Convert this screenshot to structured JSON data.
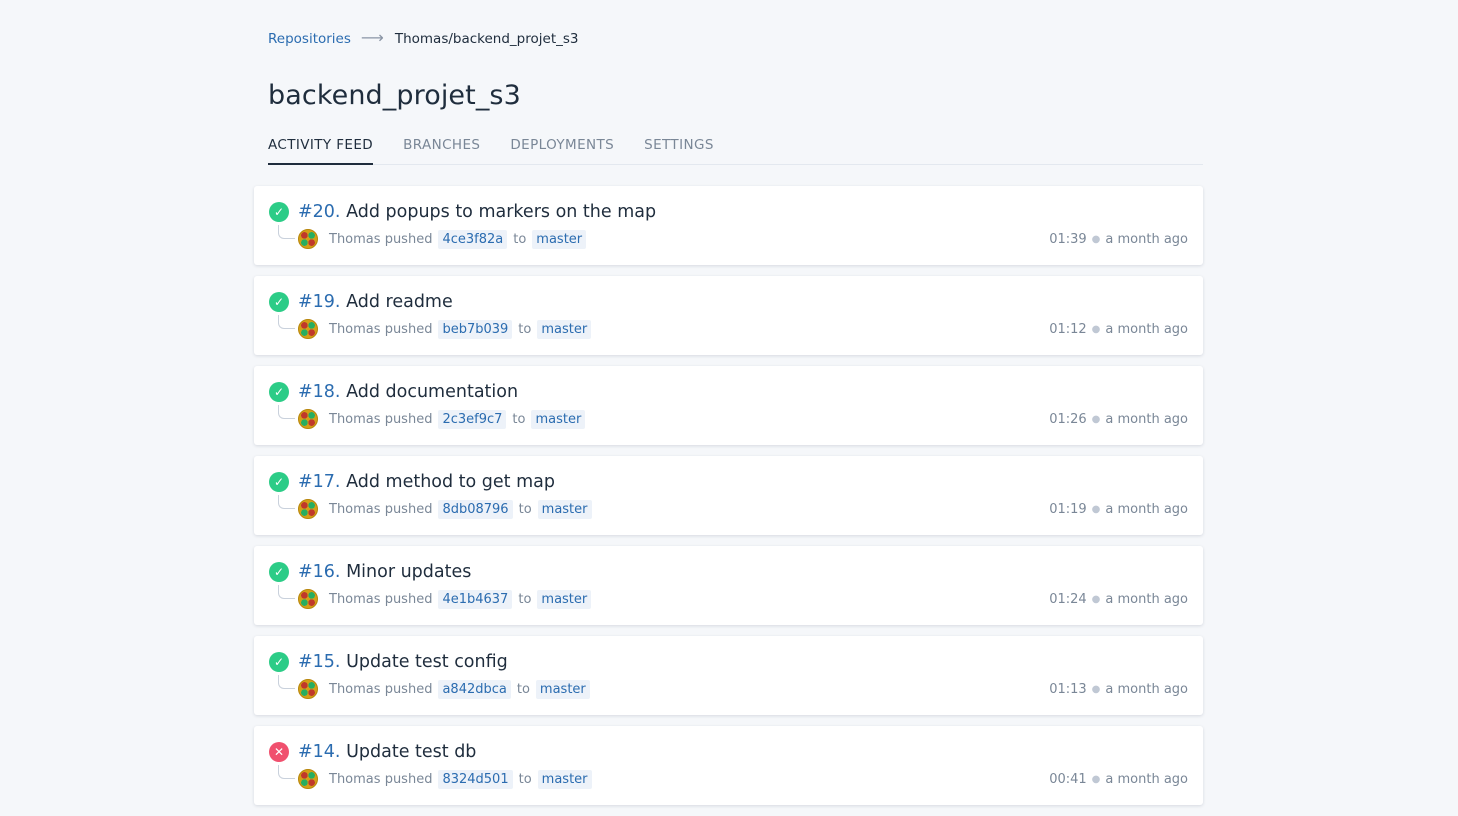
{
  "breadcrumb": {
    "root": "Repositories",
    "arrow": "⟶",
    "current": "Thomas/backend_projet_s3"
  },
  "repo": {
    "title": "backend_projet_s3"
  },
  "tabs": [
    {
      "label": "ACTIVITY FEED",
      "active": true
    },
    {
      "label": "BRANCHES",
      "active": false
    },
    {
      "label": "DEPLOYMENTS",
      "active": false
    },
    {
      "label": "SETTINGS",
      "active": false
    }
  ],
  "feed": [
    {
      "status": "passed",
      "number": "#20.",
      "message": "Add popups to markers on the map",
      "author": "Thomas",
      "action": "pushed",
      "commit": "4ce3f82a",
      "to": "to",
      "branch": "master",
      "duration": "01:39",
      "time": "a month ago"
    },
    {
      "status": "passed",
      "number": "#19.",
      "message": "Add readme",
      "author": "Thomas",
      "action": "pushed",
      "commit": "beb7b039",
      "to": "to",
      "branch": "master",
      "duration": "01:12",
      "time": "a month ago"
    },
    {
      "status": "passed",
      "number": "#18.",
      "message": "Add documentation",
      "author": "Thomas",
      "action": "pushed",
      "commit": "2c3ef9c7",
      "to": "to",
      "branch": "master",
      "duration": "01:26",
      "time": "a month ago"
    },
    {
      "status": "passed",
      "number": "#17.",
      "message": "Add method to get map",
      "author": "Thomas",
      "action": "pushed",
      "commit": "8db08796",
      "to": "to",
      "branch": "master",
      "duration": "01:19",
      "time": "a month ago"
    },
    {
      "status": "passed",
      "number": "#16.",
      "message": "Minor updates",
      "author": "Thomas",
      "action": "pushed",
      "commit": "4e1b4637",
      "to": "to",
      "branch": "master",
      "duration": "01:24",
      "time": "a month ago"
    },
    {
      "status": "passed",
      "number": "#15.",
      "message": "Update test config",
      "author": "Thomas",
      "action": "pushed",
      "commit": "a842dbca",
      "to": "to",
      "branch": "master",
      "duration": "01:13",
      "time": "a month ago"
    },
    {
      "status": "failed",
      "number": "#14.",
      "message": "Update test db",
      "author": "Thomas",
      "action": "pushed",
      "commit": "8324d501",
      "to": "to",
      "branch": "master",
      "duration": "00:41",
      "time": "a month ago"
    }
  ],
  "icons": {
    "passed": "check-circle-icon",
    "failed": "x-circle-icon"
  },
  "colors": {
    "passed": "#2ccc87",
    "failed": "#f0506e",
    "link": "#2b6cb0"
  }
}
